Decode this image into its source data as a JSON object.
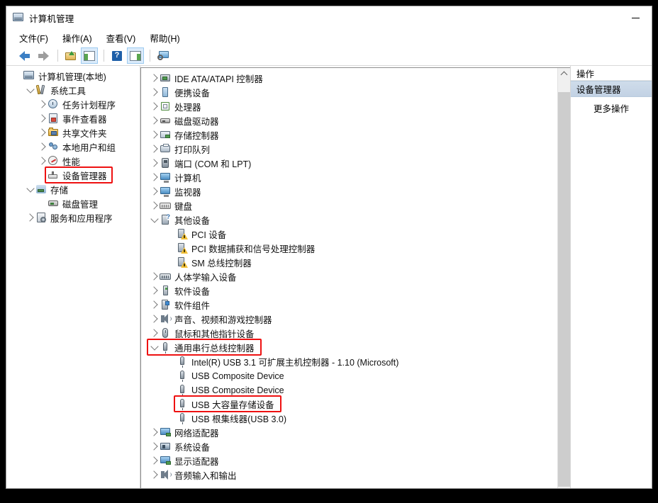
{
  "window": {
    "title": "计算机管理",
    "icon": "computer-management-icon",
    "minimize_label": "—"
  },
  "menubar": [
    {
      "label": "文件(F)",
      "key": "F",
      "text": "文件"
    },
    {
      "label": "操作(A)",
      "key": "A",
      "text": "操作"
    },
    {
      "label": "查看(V)",
      "key": "V",
      "text": "查看"
    },
    {
      "label": "帮助(H)",
      "key": "H",
      "text": "帮助"
    }
  ],
  "toolbar": [
    {
      "name": "back-button",
      "icon": "back-arrow-icon",
      "pressed": false
    },
    {
      "name": "forward-button",
      "icon": "forward-arrow-icon",
      "pressed": false
    },
    {
      "name": "up-one-level-button",
      "icon": "folder-up-icon",
      "pressed": false
    },
    {
      "name": "show-hide-console-tree-button",
      "icon": "console-tree-icon",
      "pressed": true
    },
    {
      "name": "help-button",
      "icon": "help-question-icon",
      "pressed": false
    },
    {
      "name": "show-hide-action-pane-button",
      "icon": "action-pane-icon",
      "pressed": true
    },
    {
      "name": "scan-for-hardware-changes-button",
      "icon": "scan-hardware-icon",
      "pressed": false
    }
  ],
  "tree": {
    "nodes": [
      {
        "label": "计算机管理(本地)",
        "indent": 0,
        "expander": "none",
        "icon": "computer-management-icon",
        "icontype": "compmgmt"
      },
      {
        "label": "系统工具",
        "indent": 1,
        "expander": "down",
        "icon": "system-tools-icon",
        "icontype": "tools"
      },
      {
        "label": "任务计划程序",
        "indent": 2,
        "expander": "right",
        "icon": "task-scheduler-icon",
        "icontype": "clock"
      },
      {
        "label": "事件查看器",
        "indent": 2,
        "expander": "right",
        "icon": "event-viewer-icon",
        "icontype": "event"
      },
      {
        "label": "共享文件夹",
        "indent": 2,
        "expander": "right",
        "icon": "shared-folders-icon",
        "icontype": "foldershare"
      },
      {
        "label": "本地用户和组",
        "indent": 2,
        "expander": "right",
        "icon": "local-users-groups-icon",
        "icontype": "users"
      },
      {
        "label": "性能",
        "indent": 2,
        "expander": "right",
        "icon": "performance-icon",
        "icontype": "perf"
      },
      {
        "label": "设备管理器",
        "indent": 2,
        "expander": "none",
        "icon": "device-manager-icon",
        "icontype": "devmgr",
        "highlight": true
      },
      {
        "label": "存储",
        "indent": 1,
        "expander": "down",
        "icon": "storage-icon",
        "icontype": "storage"
      },
      {
        "label": "磁盘管理",
        "indent": 2,
        "expander": "none",
        "icon": "disk-management-icon",
        "icontype": "disk"
      },
      {
        "label": "服务和应用程序",
        "indent": 1,
        "expander": "right",
        "icon": "services-applications-icon",
        "icontype": "services"
      }
    ]
  },
  "devices": {
    "nodes": [
      {
        "label": "IDE ATA/ATAPI 控制器",
        "indent": 0,
        "expander": "right",
        "icon": "ide-controller-icon",
        "icontype": "ide"
      },
      {
        "label": "便携设备",
        "indent": 0,
        "expander": "right",
        "icon": "portable-device-icon",
        "icontype": "portable"
      },
      {
        "label": "处理器",
        "indent": 0,
        "expander": "right",
        "icon": "processor-icon",
        "icontype": "cpu"
      },
      {
        "label": "磁盘驱动器",
        "indent": 0,
        "expander": "right",
        "icon": "disk-drive-icon",
        "icontype": "hdd"
      },
      {
        "label": "存储控制器",
        "indent": 0,
        "expander": "right",
        "icon": "storage-controller-icon",
        "icontype": "storctrl"
      },
      {
        "label": "打印队列",
        "indent": 0,
        "expander": "right",
        "icon": "print-queue-icon",
        "icontype": "printer"
      },
      {
        "label": "端口 (COM 和 LPT)",
        "indent": 0,
        "expander": "right",
        "icon": "ports-icon",
        "icontype": "port"
      },
      {
        "label": "计算机",
        "indent": 0,
        "expander": "right",
        "icon": "computer-icon",
        "icontype": "computer"
      },
      {
        "label": "监视器",
        "indent": 0,
        "expander": "right",
        "icon": "monitor-icon",
        "icontype": "computer"
      },
      {
        "label": "键盘",
        "indent": 0,
        "expander": "right",
        "icon": "keyboard-icon",
        "icontype": "keyboard"
      },
      {
        "label": "其他设备",
        "indent": 0,
        "expander": "down",
        "icon": "other-devices-icon",
        "icontype": "other"
      },
      {
        "label": "PCI 设备",
        "indent": 1,
        "expander": "none",
        "icon": "unknown-device-warning-icon",
        "icontype": "unknown"
      },
      {
        "label": "PCI 数据捕获和信号处理控制器",
        "indent": 1,
        "expander": "none",
        "icon": "unknown-device-warning-icon",
        "icontype": "unknown"
      },
      {
        "label": "SM 总线控制器",
        "indent": 1,
        "expander": "none",
        "icon": "unknown-device-warning-icon",
        "icontype": "unknown"
      },
      {
        "label": "人体学输入设备",
        "indent": 0,
        "expander": "right",
        "icon": "human-interface-device-icon",
        "icontype": "hid"
      },
      {
        "label": "软件设备",
        "indent": 0,
        "expander": "right",
        "icon": "software-device-icon",
        "icontype": "swdev"
      },
      {
        "label": "软件组件",
        "indent": 0,
        "expander": "right",
        "icon": "software-component-icon",
        "icontype": "swcomp"
      },
      {
        "label": "声音、视频和游戏控制器",
        "indent": 0,
        "expander": "right",
        "icon": "sound-video-game-controller-icon",
        "icontype": "sound"
      },
      {
        "label": "鼠标和其他指针设备",
        "indent": 0,
        "expander": "right",
        "icon": "mouse-pointing-device-icon",
        "icontype": "mouse"
      },
      {
        "label": "通用串行总线控制器",
        "indent": 0,
        "expander": "down",
        "icon": "usb-controller-icon",
        "icontype": "usb",
        "highlight": true
      },
      {
        "label": "Intel(R) USB 3.1 可扩展主机控制器 - 1.10 (Microsoft)",
        "indent": 1,
        "expander": "none",
        "icon": "usb-device-icon",
        "icontype": "usb"
      },
      {
        "label": "USB Composite Device",
        "indent": 1,
        "expander": "none",
        "icon": "usb-device-icon",
        "icontype": "usb"
      },
      {
        "label": "USB Composite Device",
        "indent": 1,
        "expander": "none",
        "icon": "usb-device-icon",
        "icontype": "usb"
      },
      {
        "label": "USB 大容量存储设备",
        "indent": 1,
        "expander": "none",
        "icon": "usb-mass-storage-icon",
        "icontype": "usb",
        "highlight": true
      },
      {
        "label": "USB 根集线器(USB 3.0)",
        "indent": 1,
        "expander": "none",
        "icon": "usb-root-hub-icon",
        "icontype": "usb"
      },
      {
        "label": "网络适配器",
        "indent": 0,
        "expander": "right",
        "icon": "network-adapter-icon",
        "icontype": "net"
      },
      {
        "label": "系统设备",
        "indent": 0,
        "expander": "right",
        "icon": "system-device-icon",
        "icontype": "sysdev"
      },
      {
        "label": "显示适配器",
        "indent": 0,
        "expander": "right",
        "icon": "display-adapter-icon",
        "icontype": "display"
      },
      {
        "label": "音频输入和输出",
        "indent": 0,
        "expander": "right",
        "icon": "audio-input-output-icon",
        "icontype": "sound"
      }
    ]
  },
  "actions": {
    "header": "操作",
    "selected": "设备管理器",
    "more": "更多操作"
  },
  "colors": {
    "highlight_red": "#ee1111",
    "selection_blue": "#c2d2e4",
    "toolbar_pressed": "#dcecfb"
  }
}
